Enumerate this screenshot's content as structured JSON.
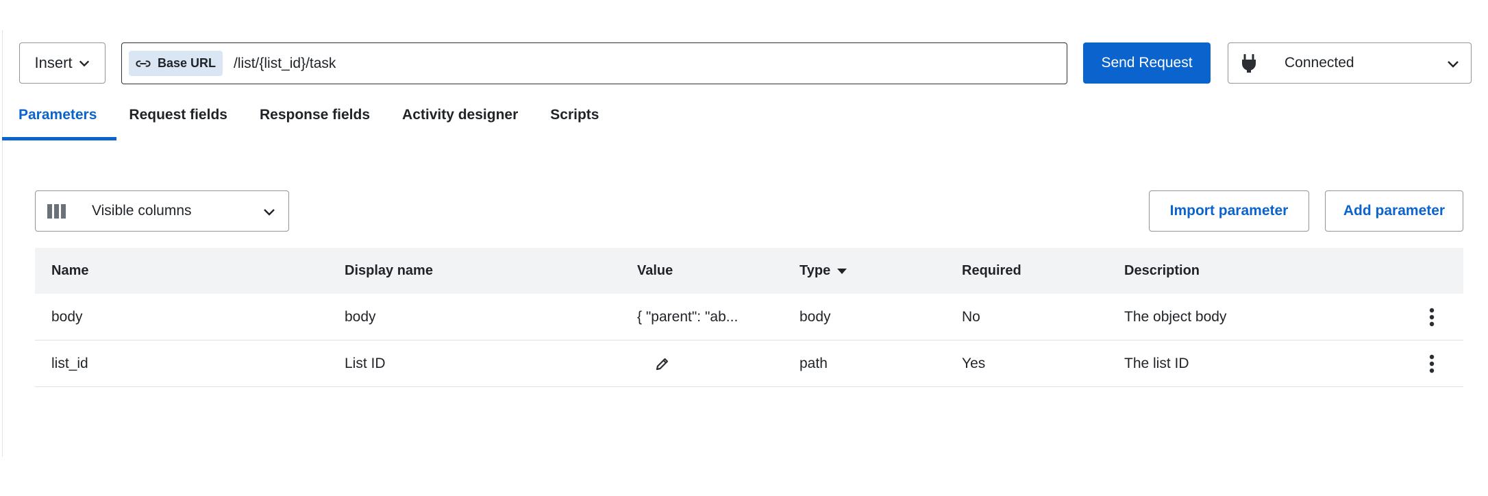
{
  "toolbar": {
    "insert_label": "Insert",
    "base_url_label": "Base URL",
    "url_path": "/list/{list_id}/task",
    "send_label": "Send Request",
    "connection_label": "Connected"
  },
  "tabs": [
    {
      "label": "Parameters",
      "active": true
    },
    {
      "label": "Request fields",
      "active": false
    },
    {
      "label": "Response fields",
      "active": false
    },
    {
      "label": "Activity designer",
      "active": false
    },
    {
      "label": "Scripts",
      "active": false
    }
  ],
  "params": {
    "visible_columns_label": "Visible columns",
    "import_label": "Import parameter",
    "add_label": "Add parameter",
    "columns": [
      "Name",
      "Display name",
      "Value",
      "Type",
      "Required",
      "Description"
    ],
    "rows": [
      {
        "name": "body",
        "display_name": "body",
        "value": "{ \"parent\": \"ab...",
        "type": "body",
        "required": "No",
        "description": "The object body"
      },
      {
        "name": "list_id",
        "display_name": "List ID",
        "value": "",
        "type": "path",
        "required": "Yes",
        "description": "The list ID"
      }
    ]
  },
  "colors": {
    "accent": "#0b63ce",
    "header_bg": "#f2f3f5",
    "chip_bg": "#dbe6f5"
  }
}
